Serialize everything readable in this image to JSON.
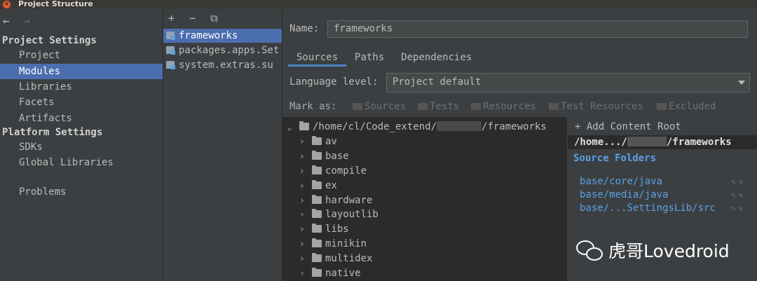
{
  "window": {
    "title": "Project Structure"
  },
  "sidebar": {
    "nav_back": "←",
    "nav_forward": "→",
    "project_settings_header": "Project Settings",
    "project_items": [
      "Project",
      "Modules",
      "Libraries",
      "Facets",
      "Artifacts"
    ],
    "platform_settings_header": "Platform Settings",
    "platform_items": [
      "SDKs",
      "Global Libraries"
    ],
    "problems": "Problems",
    "selected": "Modules"
  },
  "modules": {
    "toolbar": {
      "add": "+",
      "remove": "−",
      "copy": "⧉"
    },
    "items": [
      "frameworks",
      "packages.apps.Set",
      "system.extras.su"
    ],
    "selected": "frameworks"
  },
  "detail": {
    "name_label": "Name:",
    "name_value": "frameworks",
    "tabs": [
      "Sources",
      "Paths",
      "Dependencies"
    ],
    "active_tab": "Sources",
    "language_level_label": "Language level:",
    "language_level_value": "Project default",
    "mark_as_label": "Mark as:",
    "mark_as_options": [
      "Sources",
      "Tests",
      "Resources",
      "Test Resources",
      "Excluded"
    ]
  },
  "tree": {
    "root_prefix": "/home/cl/Code_extend/",
    "root_suffix": "/frameworks",
    "children": [
      "av",
      "base",
      "compile",
      "ex",
      "hardware",
      "layoutlib",
      "libs",
      "minikin",
      "multidex",
      "native"
    ]
  },
  "roots": {
    "add_content_root": "Add Content Root",
    "root_path_prefix": "/home.../",
    "root_path_suffix": "/frameworks",
    "source_folders_header": "Source Folders",
    "source_folders": [
      "base/core/java",
      "base/media/java",
      "base/...SettingsLib/src"
    ]
  },
  "watermark": {
    "text": "虎哥Lovedroid"
  }
}
